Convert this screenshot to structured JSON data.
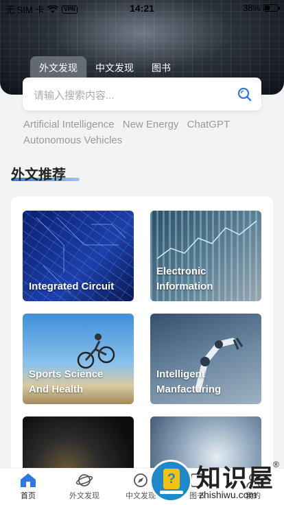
{
  "status_bar": {
    "carrier": "无 SIM 卡",
    "vpn": "VPN",
    "time": "14:21",
    "battery_text": "38%",
    "battery_level": 0.38
  },
  "header": {
    "tabs": [
      {
        "label": "外文发现",
        "active": true
      },
      {
        "label": "中文发现",
        "active": false
      },
      {
        "label": "图书",
        "active": false
      }
    ],
    "search_placeholder": "请输入搜索内容..."
  },
  "hot_words": [
    "Artificial Intelligence",
    "New Energy",
    "ChatGPT",
    "Autonomous Vehicles"
  ],
  "section": {
    "title": "外文推荐",
    "cards": [
      {
        "label": "Integrated Circuit"
      },
      {
        "label": "Electronic\nInformation"
      },
      {
        "label": "Sports Science\nAnd Health"
      },
      {
        "label": "Intelligent\nManfacturing"
      },
      {
        "label": ""
      },
      {
        "label": ""
      }
    ]
  },
  "tab_bar": {
    "items": [
      {
        "label": "首页",
        "icon": "home-icon",
        "active": true
      },
      {
        "label": "外文发现",
        "icon": "planet-icon",
        "active": false
      },
      {
        "label": "中文发现",
        "icon": "compass-icon",
        "active": false
      },
      {
        "label": "图书",
        "icon": "book-icon",
        "active": false
      },
      {
        "label": "我的",
        "icon": "user-icon",
        "active": false
      }
    ]
  },
  "watermark": {
    "cn": "知识屋",
    "reg": "®",
    "en": "zhishiwu.com"
  },
  "colors": {
    "accent": "#3a7bd5",
    "page_bg": "#f2f3f5"
  }
}
